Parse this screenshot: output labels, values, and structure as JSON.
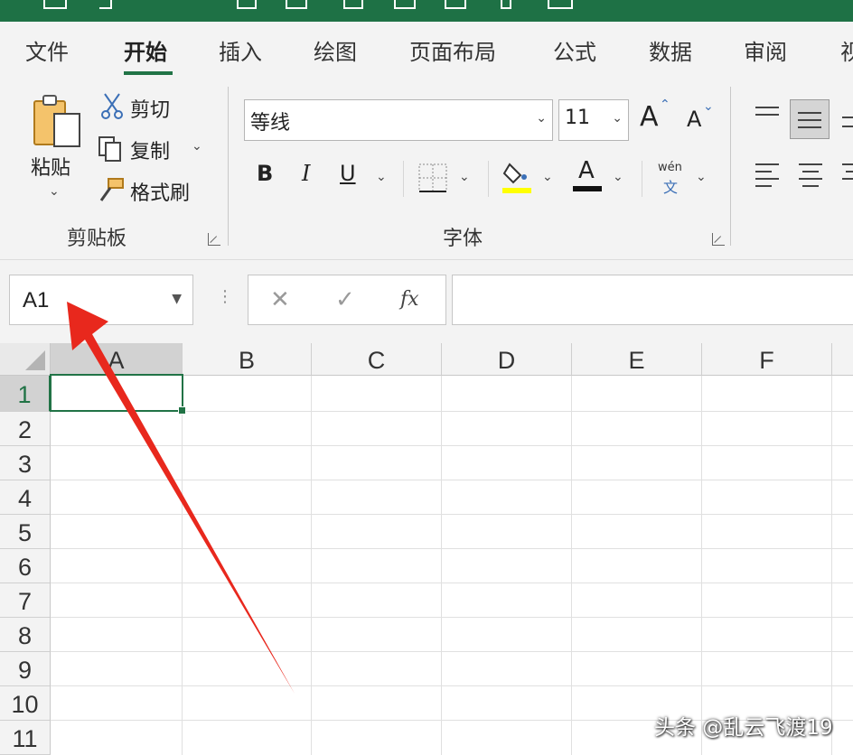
{
  "ribbon": {
    "tabs": [
      "文件",
      "开始",
      "插入",
      "绘图",
      "页面布局",
      "公式",
      "数据",
      "审阅",
      "视"
    ],
    "active_tab": "开始",
    "clipboard": {
      "paste_label": "粘贴",
      "cut_label": "剪切",
      "copy_label": "复制",
      "format_painter_label": "格式刷",
      "group_label": "剪贴板"
    },
    "font": {
      "font_name": "等线",
      "font_size": "11",
      "grow_label": "A",
      "shrink_label": "A",
      "bold": "B",
      "italic": "I",
      "underline": "U",
      "font_color_label": "A",
      "phonetic_top": "wén",
      "phonetic_bottom": "文",
      "group_label": "字体"
    }
  },
  "formula_bar": {
    "name_box": "A1",
    "cancel_label": "✕",
    "enter_label": "✓",
    "fx_label": "fx",
    "formula": ""
  },
  "grid": {
    "columns": [
      "A",
      "B",
      "C",
      "D",
      "E",
      "F"
    ],
    "rows": [
      "1",
      "2",
      "3",
      "4",
      "5",
      "6",
      "7",
      "8",
      "9",
      "10",
      "11"
    ],
    "selected_cell": "A1"
  },
  "watermark": "头条 @乱云飞渡19",
  "colors": {
    "accent": "#217346",
    "highlight": "#ffff00",
    "arrow": "#e8281d"
  }
}
